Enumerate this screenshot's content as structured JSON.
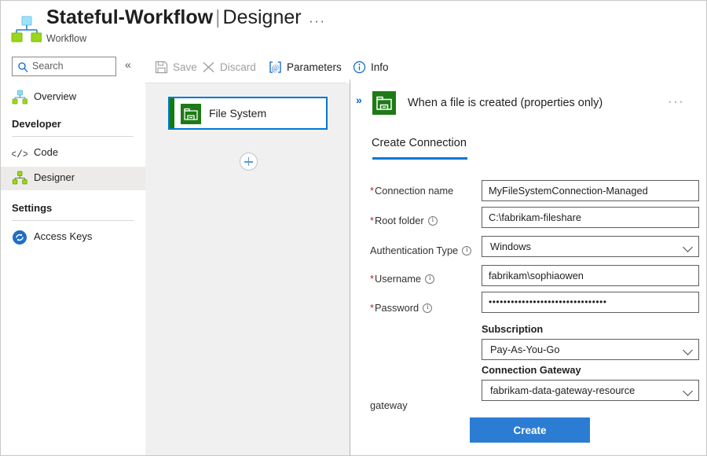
{
  "titlebar": {
    "icon": "workflow-hierarchy-icon",
    "resource_name": "Stateful-Workflow",
    "separator": "|",
    "page_name": "Designer",
    "ellipsis": "···",
    "subtitle": "Workflow"
  },
  "sidebar": {
    "search": {
      "icon": "search-icon",
      "placeholder": "Search",
      "value": ""
    },
    "collapse_icon": "«",
    "overview": {
      "icon": "workflow-hierarchy-icon",
      "label": "Overview"
    },
    "sections": [
      {
        "heading": "Developer",
        "items": [
          {
            "icon": "code-icon",
            "label": "Code",
            "selected": false
          },
          {
            "icon": "designer-icon",
            "label": "Designer",
            "selected": true
          }
        ]
      },
      {
        "heading": "Settings",
        "items": [
          {
            "icon": "access-keys-icon",
            "label": "Access Keys",
            "selected": false
          }
        ]
      }
    ]
  },
  "toolbar": {
    "save": {
      "icon": "save-icon",
      "label": "Save",
      "enabled": false
    },
    "discard": {
      "icon": "close-icon",
      "label": "Discard",
      "enabled": false
    },
    "parameters": {
      "icon": "parameters-icon",
      "label": "Parameters",
      "enabled": true
    },
    "info": {
      "icon": "info-circle-icon",
      "label": "Info",
      "enabled": true
    }
  },
  "canvas": {
    "node": {
      "icon": "file-system-icon",
      "label": "File System"
    },
    "add_button": "add-step-icon"
  },
  "panel": {
    "expand_icon": "»",
    "icon": "file-system-icon",
    "title": "When a file is created (properties only)",
    "more_icon": "···",
    "tab": "Create Connection",
    "fields": [
      {
        "label": "Connection name",
        "required": true,
        "info": false,
        "value": "MyFileSystemConnection-Managed",
        "type": "text"
      },
      {
        "label": "Root folder",
        "required": true,
        "info": true,
        "value": "C:\\fabrikam-fileshare",
        "type": "text"
      },
      {
        "label": "Authentication Type",
        "required": false,
        "info": true,
        "value": "Windows",
        "type": "select"
      },
      {
        "label": "Username",
        "required": true,
        "info": true,
        "value": "fabrikam\\sophiaowen",
        "type": "text"
      },
      {
        "label": "Password",
        "required": true,
        "info": true,
        "value": "••••••••••••••••••••••••••••••••",
        "type": "password"
      }
    ],
    "gateway_label": "gateway",
    "subscription": {
      "label": "Subscription",
      "value": "Pay-As-You-Go"
    },
    "connection_gateway": {
      "label": "Connection Gateway",
      "value": "fabrikam-data-gateway-resource"
    },
    "create_button": "Create"
  },
  "colors": {
    "accent": "#0078d4",
    "primary_button": "#2b7cd3",
    "connector_green": "#107c10",
    "required_red": "#a4262c",
    "canvas_bg": "#f0f0f0"
  }
}
